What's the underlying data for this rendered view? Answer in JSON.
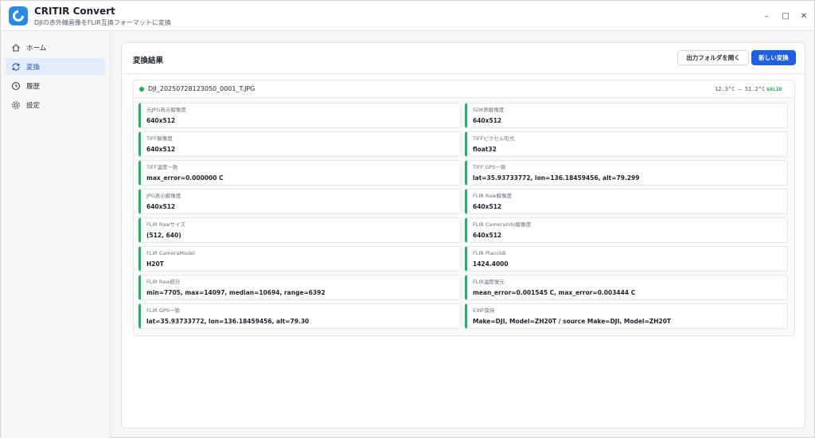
{
  "app": {
    "title": "CRITIR Convert",
    "subtitle": "DJIの赤外線画像をFLIR互換フォーマットに変換"
  },
  "window_controls": {
    "minimize": "–",
    "maximize": "□",
    "close": "✕"
  },
  "sidebar": {
    "items": [
      {
        "label": "ホーム",
        "icon": "home-icon",
        "active": false
      },
      {
        "label": "変換",
        "icon": "refresh-icon",
        "active": true
      },
      {
        "label": "履歴",
        "icon": "clock-icon",
        "active": false
      },
      {
        "label": "設定",
        "icon": "gear-icon",
        "active": false
      }
    ]
  },
  "main": {
    "title": "変換結果",
    "open_folder_label": "出力フォルダを開く",
    "new_convert_label": "新しい変換"
  },
  "result": {
    "file_name": "DJI_20250728123050_0001_T.JPG",
    "temp_range": "12.3°C – 51.2°C",
    "status": "VALID",
    "status_color": "#22a85a",
    "fields": [
      {
        "label": "元JPG表示解像度",
        "value": "640x512"
      },
      {
        "label": "SDK熱解像度",
        "value": "640x512"
      },
      {
        "label": "TIFF解像度",
        "value": "640x512"
      },
      {
        "label": "TIFFピクセル形式",
        "value": "float32"
      },
      {
        "label": "TIFF温度一致",
        "value": "max_error=0.000000 C"
      },
      {
        "label": "TIFF GPS一致",
        "value": "lat=35.93733772, lon=136.18459456, alt=79.299"
      },
      {
        "label": "JPG表示解像度",
        "value": "640x512"
      },
      {
        "label": "FLIR Raw解像度",
        "value": "640x512"
      },
      {
        "label": "FLIR Rawサイズ",
        "value": "(512, 640)"
      },
      {
        "label": "FLIR CameraInfo解像度",
        "value": "640x512"
      },
      {
        "label": "FLIR CameraModel",
        "value": "H20T"
      },
      {
        "label": "FLIR PlanckB",
        "value": "1424.4000"
      },
      {
        "label": "FLIR Raw統計",
        "value": "min=7705, max=14097, median=10694, range=6392"
      },
      {
        "label": "FLIR温度復元",
        "value": "mean_error=0.001545 C, max_error=0.003444 C"
      },
      {
        "label": "FLIR GPS一致",
        "value": "lat=35.93733772, lon=136.18459456, alt=79.30"
      },
      {
        "label": "EXIF保持",
        "value": "Make=DJI, Model=ZH20T / source Make=DJI, Model=ZH20T"
      }
    ]
  },
  "colors": {
    "accent": "#1f5fe0",
    "success": "#25b06a",
    "active_nav_bg": "#e4ecf9"
  }
}
